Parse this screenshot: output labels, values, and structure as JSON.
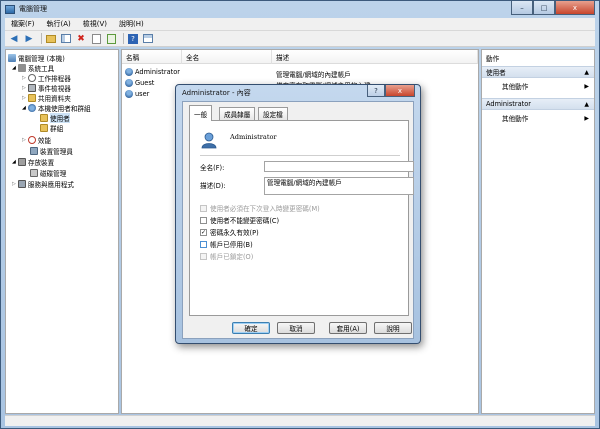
{
  "window": {
    "title": "電腦管理",
    "controls": {
      "minimize": "–",
      "maximize": "□",
      "close": "x"
    }
  },
  "menu": [
    "檔案(F)",
    "執行(A)",
    "檢視(V)",
    "說明(H)"
  ],
  "toolbar": {
    "icons": [
      "back-arrow-icon",
      "forward-arrow-icon",
      "up-folder-icon",
      "show-hide-tree-icon",
      "delete-icon",
      "properties-icon",
      "export-icon",
      "help-icon",
      "console-icon"
    ]
  },
  "tree": {
    "items": [
      {
        "label": "電腦管理 (本機)",
        "level": 0
      },
      {
        "label": "系統工具",
        "level": 1
      },
      {
        "label": "工作排程器",
        "level": 2
      },
      {
        "label": "事件檢視器",
        "level": 2
      },
      {
        "label": "共用資料夾",
        "level": 2
      },
      {
        "label": "本機使用者和群組",
        "level": 2
      },
      {
        "label": "使用者",
        "level": 3
      },
      {
        "label": "群組",
        "level": 3
      },
      {
        "label": "效能",
        "level": 2
      },
      {
        "label": "裝置管理員",
        "level": 2
      },
      {
        "label": "存放裝置",
        "level": 1
      },
      {
        "label": "磁碟管理",
        "level": 2
      },
      {
        "label": "服務與應用程式",
        "level": 1
      }
    ]
  },
  "list": {
    "columns": [
      "名稱",
      "全名",
      "描述"
    ],
    "rows": [
      {
        "name": "Administrator",
        "fullname": "",
        "desc": "管理電腦/網域的內建帳戶"
      },
      {
        "name": "Guest",
        "fullname": "",
        "desc": "供來賓存取電腦/網域之用的內建..."
      },
      {
        "name": "user",
        "fullname": "",
        "desc": ""
      }
    ]
  },
  "actions": {
    "header": "動作",
    "sections": [
      {
        "title": "使用者",
        "item": "其他動作"
      },
      {
        "title": "Administrator",
        "item": "其他動作"
      }
    ]
  },
  "dialog": {
    "title": "Administrator - 內容",
    "help": "?",
    "close": "x",
    "tabs": [
      "一般",
      "成員隸屬",
      "設定檔"
    ],
    "username": "Administrator",
    "fullname_label": "全名(F):",
    "fullname_value": "",
    "desc_label": "描述(D):",
    "desc_value": "管理電腦/網域的內建帳戶",
    "checkboxes": [
      {
        "label": "使用者必須在下次登入時變更密碼(M)",
        "checked": false,
        "disabled": true
      },
      {
        "label": "使用者不能變更密碼(C)",
        "checked": false,
        "disabled": false
      },
      {
        "label": "密碼永久有效(P)",
        "checked": true,
        "disabled": false
      },
      {
        "label": "帳戶已停用(B)",
        "checked": false,
        "disabled": false
      },
      {
        "label": "帳戶已鎖定(O)",
        "checked": false,
        "disabled": true
      }
    ],
    "buttons": {
      "ok": "確定",
      "cancel": "取消",
      "apply": "套用(A)",
      "help": "說明"
    }
  }
}
